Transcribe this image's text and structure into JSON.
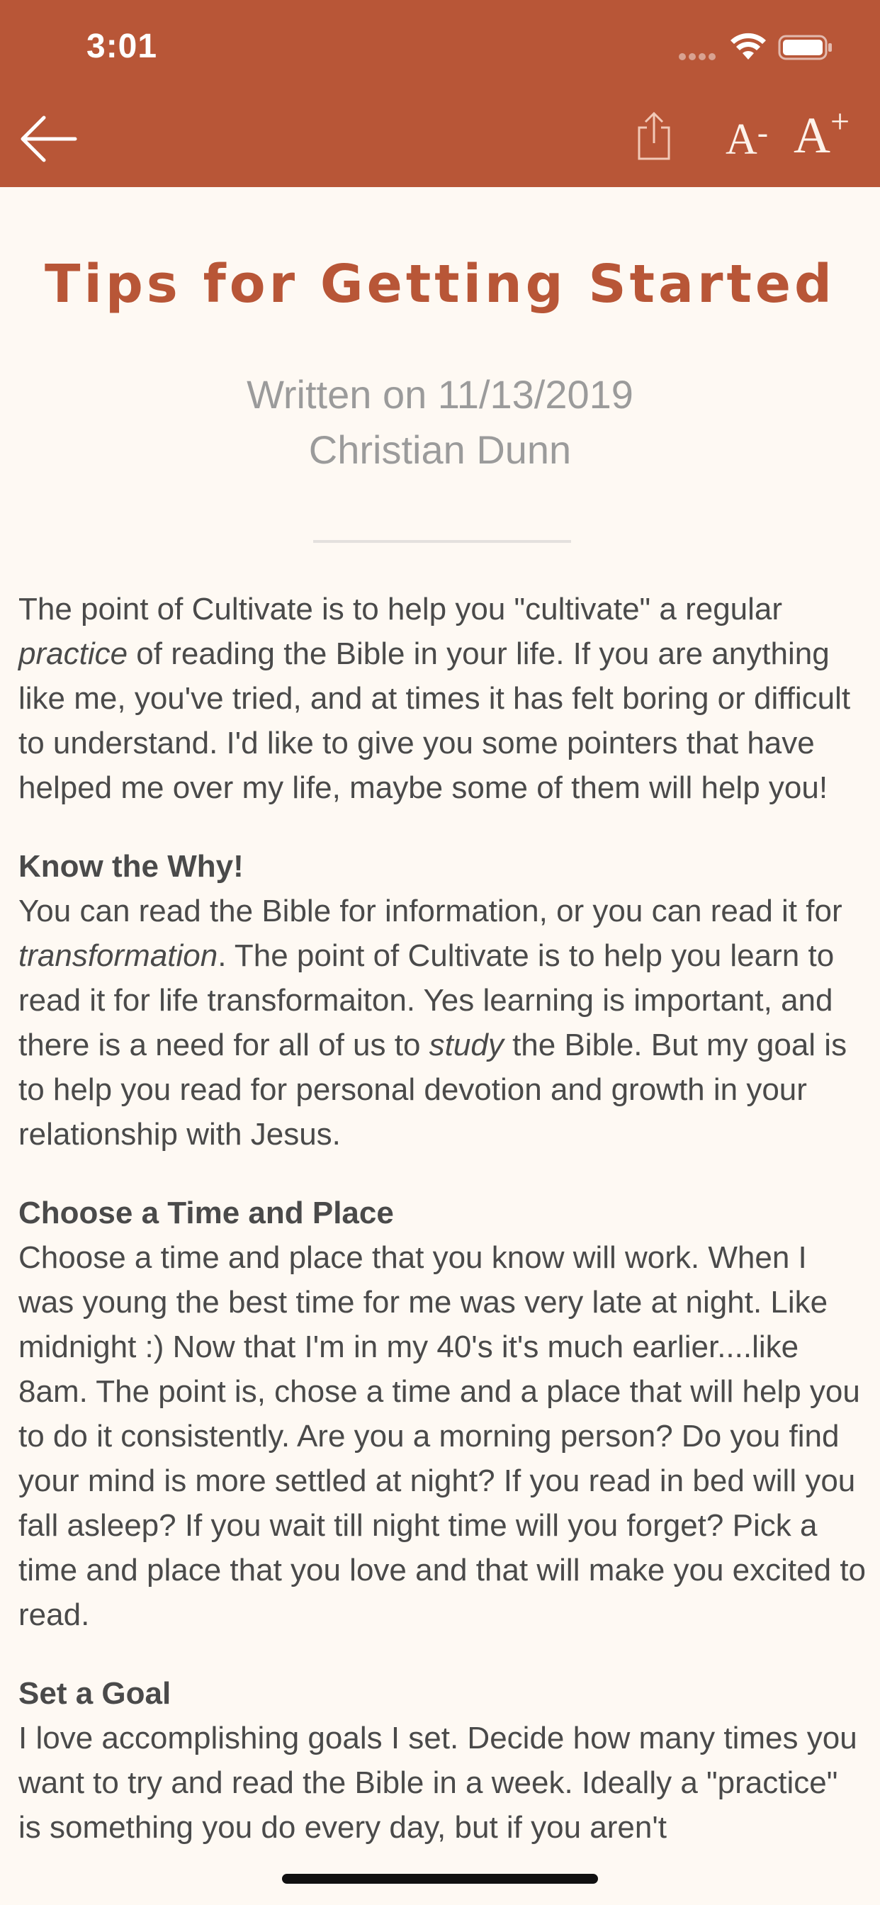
{
  "status_bar": {
    "time": "3:01"
  },
  "toolbar": {
    "back_icon": "arrow-left-icon",
    "share_icon": "share-icon",
    "font_decrease_label": "A",
    "font_decrease_mark": "-",
    "font_increase_label": "A",
    "font_increase_mark": "+"
  },
  "article": {
    "title": "Tips for Getting Started",
    "date_line": "Written on 11/13/2019",
    "author": "Christian Dunn",
    "intro": {
      "p1": "The point of Cultivate is to help you \"cultivate\" a regular ",
      "em1": "practice",
      "p2": " of reading the Bible in your life. If you are anything like me, you've tried, and at times it has felt boring or difficult to understand. I'd like to give you some pointers that have helped me over my life, maybe some of them will help you!"
    },
    "sections": [
      {
        "heading": "Know the Why!",
        "t1": "You can read the Bible for information, or you can read it for ",
        "em1": "transformation",
        "t2": ". The point of Cultivate is to help you learn to read it for life transformaiton. Yes learning is important, and there is a need for all of us to ",
        "em2": "study",
        "t3": " the Bible. But my goal is to help you read for personal devotion and growth in your relationship with Jesus."
      },
      {
        "heading": "Choose a Time and Place",
        "t1": "Choose a time and place that you know will work. When I was young the best time for me was very late at night. Like midnight :) Now that I'm in my 40's it's much earlier....like 8am. The point is, chose a time and a place that will help you to do it consistently. Are you a morning person? Do you find your mind is more settled at night? If you read in bed will you fall asleep? If you wait till night time will you forget? Pick a time and place that you love and that will make you excited to read."
      },
      {
        "heading": "Set a Goal",
        "t1": "I love accomplishing goals I set. Decide how many times you want to try and read the Bible in a week. Ideally a \"practice\" is something you do every day, but if you aren't"
      }
    ]
  },
  "colors": {
    "header": "#b85637",
    "accent": "#b85637",
    "background": "#fef9f3",
    "body_text": "#4a4a4a",
    "meta_text": "#9b9b9b"
  }
}
